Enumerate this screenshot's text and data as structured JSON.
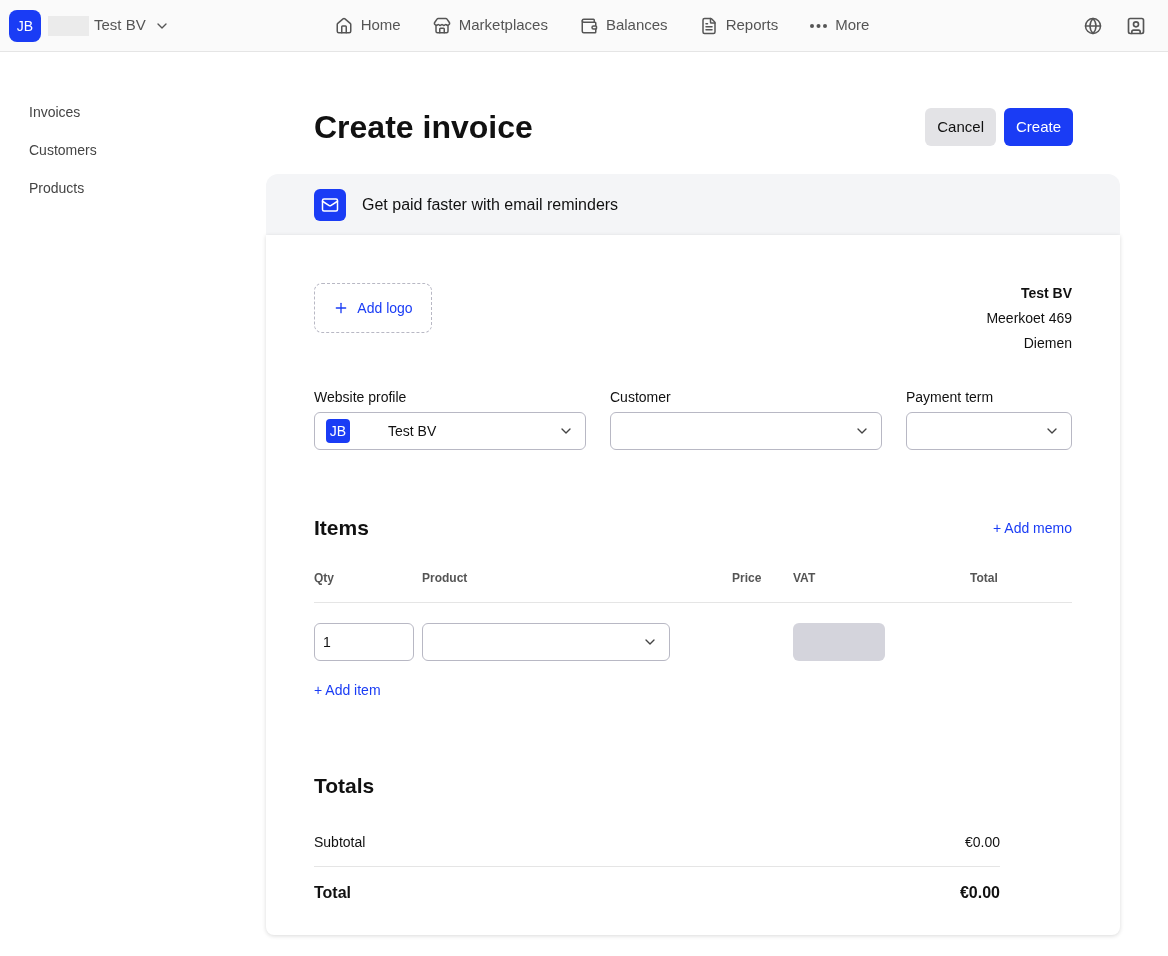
{
  "header": {
    "avatar": "JB",
    "org": "Test BV",
    "nav": [
      {
        "kind": "home",
        "label": "Home"
      },
      {
        "kind": "store",
        "label": "Marketplaces"
      },
      {
        "kind": "wallet",
        "label": "Balances"
      },
      {
        "kind": "file",
        "label": "Reports"
      },
      {
        "kind": "more",
        "label": "More"
      }
    ]
  },
  "sidebar": {
    "items": [
      "Invoices",
      "Customers",
      "Products"
    ]
  },
  "title": "Create invoice",
  "actions": {
    "cancel": "Cancel",
    "create": "Create"
  },
  "banner": "Get paid faster with email reminders",
  "invoice": {
    "add_logo": "Add logo",
    "address": [
      "Test BV",
      "Meerkoet 469",
      "Diemen"
    ],
    "fields": [
      {
        "label": "Website profile",
        "avatar": "JB",
        "value": "Test BV"
      },
      {
        "label": "Customer"
      },
      {
        "label": "Payment term"
      }
    ],
    "items": {
      "title": "Items",
      "add_memo": "+ Add memo",
      "columns": [
        "Qty",
        "Product",
        "Price",
        "VAT",
        "Total"
      ],
      "rows": [
        {
          "qty": "1"
        }
      ],
      "add_item": "+ Add item"
    },
    "totals": {
      "title": "Totals",
      "subtotal_label": "Subtotal",
      "subtotal": "€0.00",
      "total_label": "Total",
      "total": "€0.00"
    }
  }
}
